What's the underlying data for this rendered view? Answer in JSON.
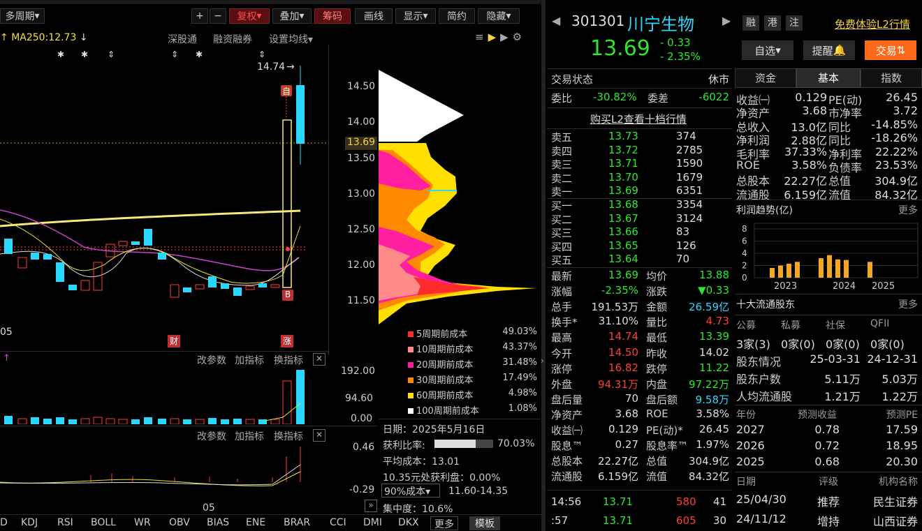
{
  "top_menu": [
    "...",
    "...",
    "...",
    "...",
    "...",
    "...",
    "...",
    "...",
    "...",
    "...",
    "...",
    "..."
  ],
  "chart_toolbar": {
    "period": "多周期",
    "plus": "+",
    "minus": "−",
    "fuquan": "复权",
    "overlay": "叠加",
    "chouma": "筹码",
    "huaxian": "画线",
    "display": "显示",
    "simple": "简约",
    "hide": "隐藏"
  },
  "ma_label": "MA250:12.73",
  "top_links": {
    "sgt": "深股通",
    "rzrq": "融资融券",
    "set_ma": "设置均线"
  },
  "price_axis": [
    "14.50",
    "14.00",
    "13.69",
    "13.50",
    "13.00",
    "12.50",
    "12.00",
    "11.50"
  ],
  "high_label": "14.74",
  "low_label": "05",
  "markers": {
    "zi": "自",
    "b": "B",
    "cai": "财",
    "zhang": "涨"
  },
  "vol_axis": [
    "192.00",
    "94.60",
    "0.00"
  ],
  "brar_axis": [
    "0.46",
    "-0.29"
  ],
  "panel_links": {
    "param": "改参数",
    "add": "加指标",
    "switch": "换指标"
  },
  "x_date": "05",
  "indicator_tabs": [
    "D",
    "KDJ",
    "RSI",
    "BOLL",
    "WR",
    "OBV",
    "BIAS",
    "ENE",
    "BRAR",
    "CCI",
    "DMI",
    "DKX"
  ],
  "more": "更多",
  "template": "模板",
  "cost_legend": [
    {
      "label": "5周期前成本",
      "value": "49.03%",
      "color": "#ff2a2a"
    },
    {
      "label": "10周期前成本",
      "value": "43.37%",
      "color": "#ff8a8a"
    },
    {
      "label": "20周期前成本",
      "value": "31.48%",
      "color": "#ff1fa0"
    },
    {
      "label": "30周期前成本",
      "value": "17.49%",
      "color": "#ff8a00"
    },
    {
      "label": "60周期前成本",
      "value": "4.98%",
      "color": "#ffe000"
    },
    {
      "label": "100周期前成本",
      "value": "1.08%",
      "color": "#ffffff"
    }
  ],
  "chip_info": {
    "date": "日期：2025年5月16日",
    "win_label": "获利比率:",
    "win_value": "70.03%",
    "win_frac": 0.7,
    "avg": "平均成本：13.01",
    "profit": "10.35元处获利盘：0.00%",
    "select": "90%成本",
    "range": "11.60-14.35",
    "conc": "集中度：10.6%"
  },
  "stock": {
    "code": "301301",
    "name": "川宁生物",
    "price": "13.69",
    "chg": "- 0.33",
    "pct": "- 2.35%",
    "tags": [
      "融",
      "港",
      "注"
    ],
    "l2": "免费体验L2行情",
    "zixuan": "自选",
    "remind": "提醒",
    "trade": "交易"
  },
  "status": {
    "label": "交易状态",
    "value": "休市"
  },
  "weibi": {
    "l1": "委比",
    "v1": "-30.82%",
    "l2": "委差",
    "v2": "-6022"
  },
  "buy_l2": "购买L2查看十档行情",
  "asks": [
    [
      "卖五",
      "13.73",
      "374"
    ],
    [
      "卖四",
      "13.72",
      "2785"
    ],
    [
      "卖三",
      "13.71",
      "1590"
    ],
    [
      "卖二",
      "13.70",
      "1679"
    ],
    [
      "卖一",
      "13.69",
      "6351"
    ]
  ],
  "bids": [
    [
      "买一",
      "13.68",
      "3354"
    ],
    [
      "买二",
      "13.67",
      "3124"
    ],
    [
      "买三",
      "13.66",
      "83"
    ],
    [
      "买四",
      "13.65",
      "126"
    ],
    [
      "买五",
      "13.64",
      "70"
    ]
  ],
  "quote": [
    [
      "最新",
      "13.69",
      "g",
      "均价",
      "13.88",
      "g"
    ],
    [
      "涨幅",
      "-2.35%",
      "g",
      "涨跌",
      "▼0.33",
      "g"
    ],
    [
      "总手",
      "191.53万",
      "w",
      "金额",
      "26.59亿",
      "c"
    ],
    [
      "换手*",
      "31.10%",
      "w",
      "量比",
      "4.73",
      "r"
    ],
    [
      "最高",
      "14.74",
      "r",
      "最低",
      "13.39",
      "g"
    ],
    [
      "今开",
      "14.50",
      "r",
      "昨收",
      "14.02",
      "w"
    ],
    [
      "涨停",
      "16.82",
      "r",
      "跌停",
      "11.22",
      "g"
    ],
    [
      "外盘",
      "94.31万",
      "r",
      "内盘",
      "97.22万",
      "g"
    ],
    [
      "盘后量",
      "70",
      "w",
      "盘后额",
      "9.58万",
      "c"
    ],
    [
      "净资产",
      "3.68",
      "w",
      "ROE",
      "3.58%",
      "w"
    ],
    [
      "收益㈠",
      "0.129",
      "w",
      "PE(动)*",
      "26.45",
      "w"
    ],
    [
      "股息™",
      "0.27",
      "w",
      "股息率™",
      "1.97%",
      "w"
    ],
    [
      "总股本",
      "22.27亿",
      "w",
      "总值",
      "304.9亿",
      "w"
    ],
    [
      "流通股",
      "6.159亿",
      "w",
      "流值",
      "84.32亿",
      "w"
    ]
  ],
  "ticks": [
    [
      "14:56",
      "13.71",
      "580",
      "41"
    ],
    [
      ":57",
      "13.71",
      "605",
      "30"
    ]
  ],
  "tabs": [
    "资金",
    "基本",
    "指数"
  ],
  "fund": [
    [
      "收益㈠",
      "0.129",
      "PE(动)",
      "26.45"
    ],
    [
      "净资产",
      "3.68",
      "市净率",
      "3.72"
    ],
    [
      "总收入",
      "13.0亿",
      "同比",
      "-14.85%"
    ],
    [
      "净利润",
      "2.88亿",
      "同比",
      "-18.26%"
    ],
    [
      "毛利率",
      "37.33%",
      "净利率",
      "22.22%"
    ],
    [
      "ROE",
      "3.58%",
      "负债率",
      "23.53%"
    ],
    [
      "总股本",
      "22.27亿",
      "总值",
      "304.9亿"
    ],
    [
      "流通股",
      "6.159亿",
      "流值",
      "84.32亿"
    ]
  ],
  "profit_trend": {
    "title": "利润趋势(亿)",
    "more": "更多",
    "yticks": [
      "8",
      "6",
      "4",
      "2",
      "0"
    ],
    "years": [
      "2023",
      "2024",
      "2025"
    ]
  },
  "chart_data": {
    "type": "bar",
    "title": "利润趋势(亿)",
    "categories": [
      "2023Q1",
      "2023Q2",
      "2023Q3",
      "2023Q4",
      "2024Q1",
      "2024Q2",
      "2024Q3",
      "2024Q4",
      "2025Q1"
    ],
    "values": [
      1.6,
      2.0,
      2.3,
      2.6,
      3.2,
      3.7,
      3.0,
      2.9,
      2.6
    ],
    "ylim": [
      0,
      8
    ]
  },
  "holders": {
    "title": "十大流通股东",
    "more": "更多",
    "h": [
      "公募",
      "私募",
      "社保",
      "QFII"
    ],
    "v": [
      "3家(3)",
      "0家(0)",
      "0家(0)",
      "0家(0)"
    ],
    "rows": [
      [
        "股东情况",
        "25-03-31",
        "24-12-31"
      ],
      [
        "股东户数",
        "5.11万",
        "5.03万"
      ],
      [
        "人均流通股",
        "1.21万",
        "1.22万"
      ]
    ]
  },
  "forecast": {
    "h": [
      "年份",
      "预测收益",
      "预测PE"
    ],
    "rows": [
      [
        "2027",
        "0.78",
        "17.59"
      ],
      [
        "2026",
        "0.72",
        "18.95"
      ],
      [
        "2025",
        "0.68",
        "20.30"
      ]
    ]
  },
  "rating": {
    "h": [
      "日期",
      "评级",
      "机构名称"
    ],
    "rows": [
      [
        "25/04/30",
        "推荐",
        "民生证券"
      ],
      [
        "24/11/12",
        "增持",
        "山西证券"
      ]
    ]
  }
}
